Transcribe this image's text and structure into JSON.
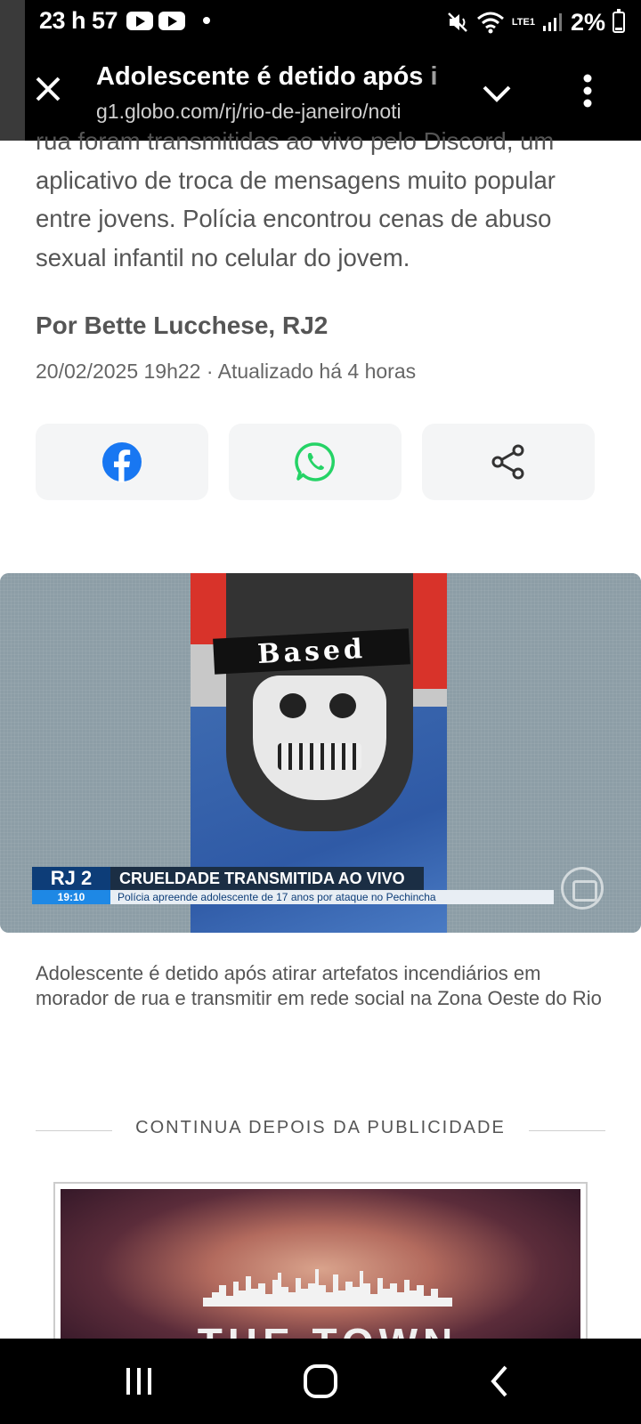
{
  "status_bar": {
    "time": "23 h 57",
    "network_label": "LTE1",
    "battery_text": "2%"
  },
  "tab_header": {
    "title": "Adolescente é detido após i",
    "url": "g1.globo.com/rj/rio-de-janeiro/noti"
  },
  "article": {
    "lede": "rua foram transmitidas ao vivo pelo Discord, um aplicativo de troca de mensagens muito popular entre jovens. Polícia encontrou cenas de abuso sexual infantil no celular do jovem.",
    "byline": "Por Bette Lucchese, RJ2",
    "dateline": "20/02/2025 19h22 · Atualizado há 4 horas",
    "share_buttons": [
      "facebook-icon",
      "whatsapp-icon",
      "share-icon"
    ],
    "video": {
      "overlay_text": "Based",
      "program_logo": "RJ 2",
      "program_time": "19:10",
      "headline": "CRUELDADE TRANSMITIDA AO VIVO",
      "subline": "Polícia apreende adolescente de 17 anos por ataque no Pechincha"
    },
    "caption": "Adolescente é detido após atirar artefatos incendiários em morador de rua e transmitir em rede social na Zona Oeste do Rio",
    "ad_label": "CONTINUA DEPOIS DA PUBLICIDADE",
    "ad_wordmark": "THE TOWN CARD"
  },
  "colors": {
    "facebook": "#1877f2",
    "whatsapp": "#25d366",
    "text_gray": "#555555"
  }
}
